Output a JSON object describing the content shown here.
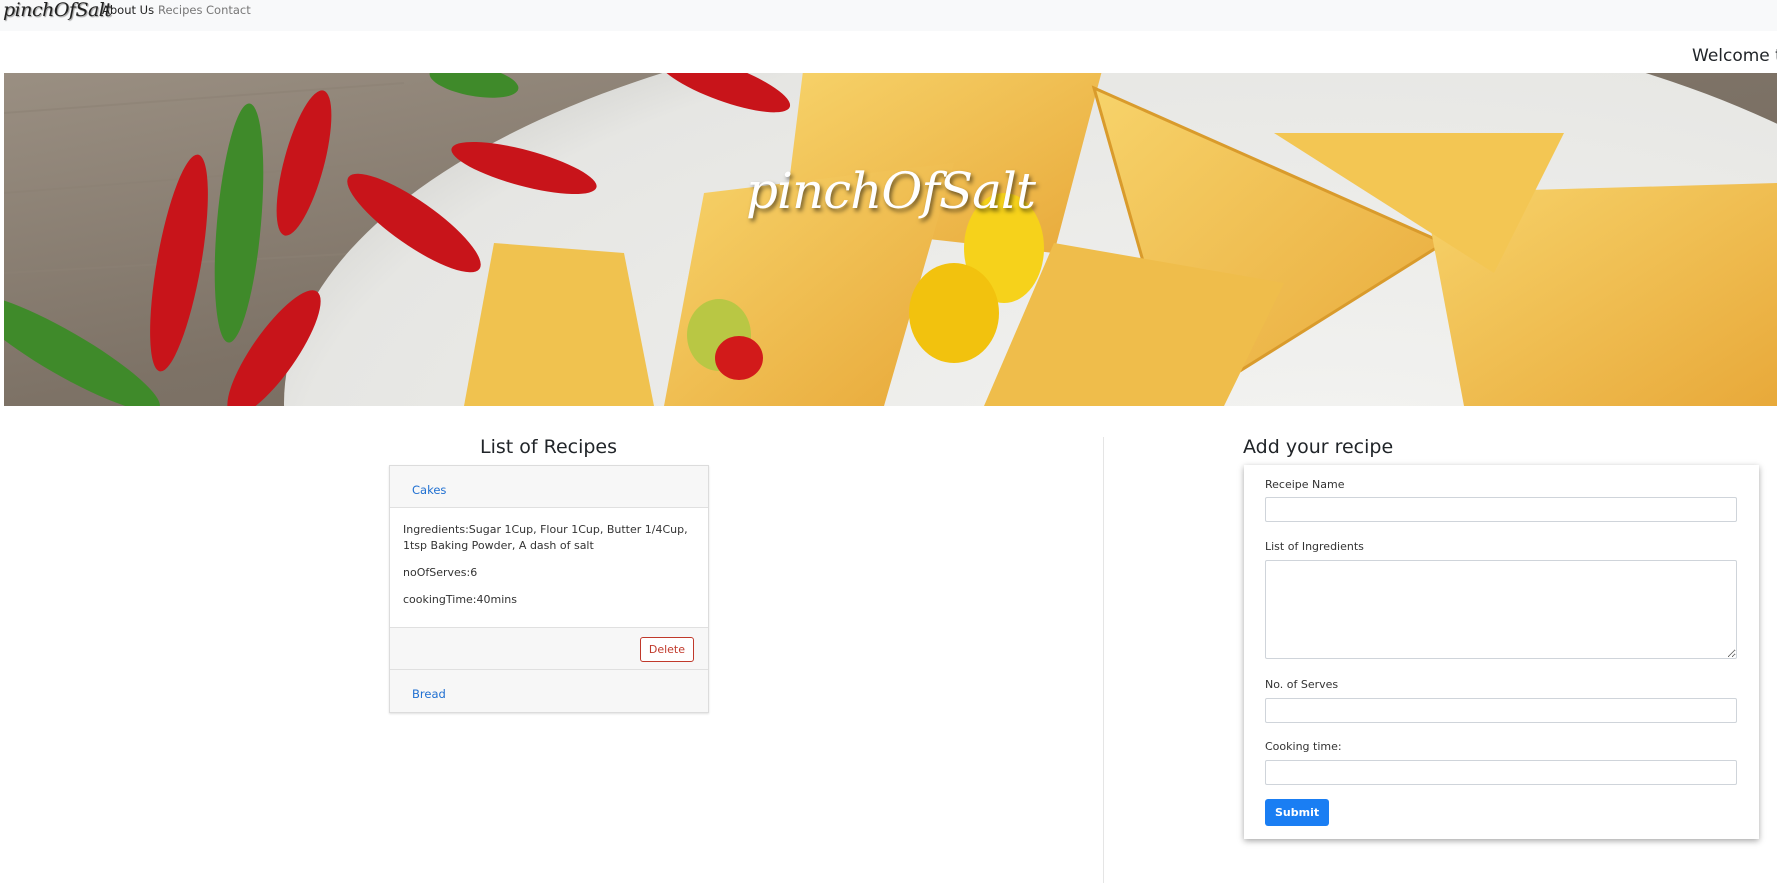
{
  "navbar": {
    "brand": "pinchOfSalt",
    "links": [
      {
        "label": "About Us"
      },
      {
        "label": "Recipes"
      },
      {
        "label": "Contact"
      }
    ]
  },
  "welcome_text": "Welcome t",
  "hero": {
    "title": "pinchOfSalt"
  },
  "recipes": {
    "heading": "List of Recipes",
    "items": [
      {
        "name": "Cakes",
        "ingredients": "Ingredients:Sugar 1Cup, Flour 1Cup, Butter 1/4Cup, 1tsp Baking Powder, A dash of salt",
        "serves": "noOfServes:6",
        "cooking_time": "cookingTime:40mins",
        "delete_label": "Delete"
      },
      {
        "name": "Bread"
      }
    ]
  },
  "form": {
    "heading": "Add your recipe",
    "name_label": "Receipe Name",
    "name_value": "",
    "ingredients_label": "List of Ingredients",
    "ingredients_value": "",
    "serves_label": "No. of Serves",
    "serves_value": "",
    "cooking_label": "Cooking time:",
    "cooking_value": "",
    "submit_label": "Submit"
  },
  "colors": {
    "link": "#1f6fd1",
    "danger": "#c0392b",
    "primary": "#1a7ef3"
  }
}
